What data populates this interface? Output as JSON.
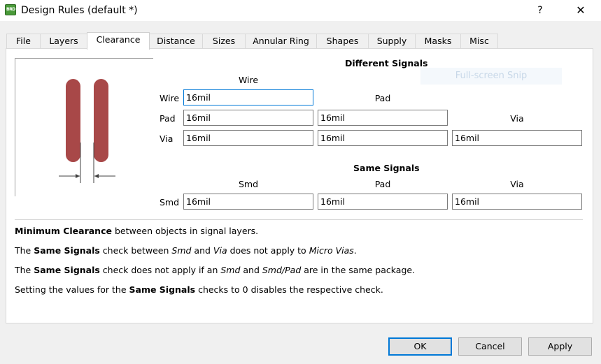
{
  "window": {
    "title": "Design Rules (default *)",
    "app_icon_text": "BRD",
    "help": "?",
    "close": "✕"
  },
  "tabs": [
    "File",
    "Layers",
    "Clearance",
    "Distance",
    "Sizes",
    "Annular Ring",
    "Shapes",
    "Supply",
    "Masks",
    "Misc"
  ],
  "active_tab": "Clearance",
  "different": {
    "heading": "Different Signals",
    "col_wire": "Wire",
    "col_pad": "Pad",
    "col_via": "Via",
    "row_wire": "Wire",
    "row_pad": "Pad",
    "row_via": "Via",
    "wire_wire": "16mil",
    "pad_wire": "16mil",
    "pad_pad": "16mil",
    "via_wire": "16mil",
    "via_pad": "16mil",
    "via_via": "16mil"
  },
  "same": {
    "heading": "Same Signals",
    "col_smd": "Smd",
    "col_pad": "Pad",
    "col_via": "Via",
    "row_smd": "Smd",
    "smd_smd": "16mil",
    "smd_pad": "16mil",
    "smd_via": "16mil"
  },
  "overlay": "Full-screen Snip",
  "info": {
    "l1_b1": "Minimum Clearance",
    "l1_t1": " between objects in signal layers.",
    "l2_t1": "The ",
    "l2_b1": "Same Signals",
    "l2_t2": " check between ",
    "l2_i1": "Smd",
    "l2_t3": " and ",
    "l2_i2": "Via",
    "l2_t4": " does not apply to ",
    "l2_i3": "Micro Vias",
    "l2_t5": ".",
    "l3_t1": "The ",
    "l3_b1": "Same Signals",
    "l3_t2": " check does not apply if an ",
    "l3_i1": "Smd",
    "l3_t3": " and ",
    "l3_i2": "Smd/Pad",
    "l3_t4": " are in the same package.",
    "l4_t1": "Setting the values for the ",
    "l4_b1": "Same Signals",
    "l4_t2": " checks to 0 disables the respective check."
  },
  "buttons": {
    "ok": "OK",
    "cancel": "Cancel",
    "apply": "Apply"
  },
  "colors": {
    "trace": "#a84848",
    "accent": "#0078d7"
  }
}
